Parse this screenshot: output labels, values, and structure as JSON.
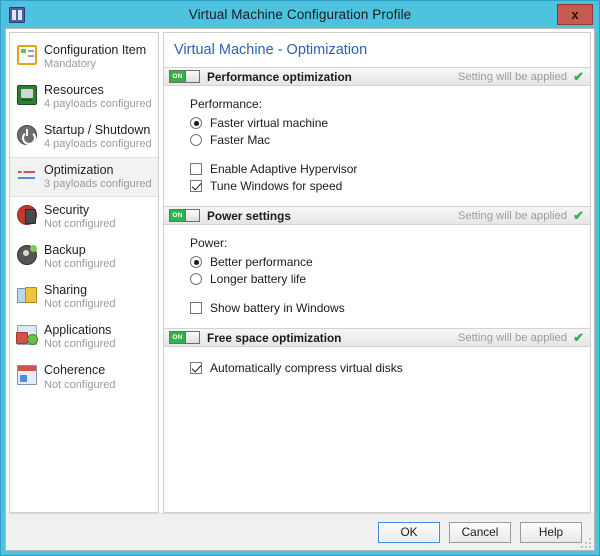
{
  "window": {
    "title": "Virtual Machine Configuration Profile",
    "app_icon": "window-panes-icon",
    "close_label": "x",
    "accent_color": "#4ec3e0",
    "close_color": "#c75b52"
  },
  "sidebar": {
    "items": [
      {
        "label": "Configuration Item",
        "sub": "Mandatory",
        "icon": "config-item-icon",
        "selected": false
      },
      {
        "label": "Resources",
        "sub": "4 payloads configured",
        "icon": "resources-icon",
        "selected": false
      },
      {
        "label": "Startup / Shutdown",
        "sub": "4 payloads configured",
        "icon": "power-icon",
        "selected": false
      },
      {
        "label": "Optimization",
        "sub": "3 payloads configured",
        "icon": "optimization-icon",
        "selected": true
      },
      {
        "label": "Security",
        "sub": "Not configured",
        "icon": "security-icon",
        "selected": false
      },
      {
        "label": "Backup",
        "sub": "Not configured",
        "icon": "backup-icon",
        "selected": false
      },
      {
        "label": "Sharing",
        "sub": "Not configured",
        "icon": "sharing-icon",
        "selected": false
      },
      {
        "label": "Applications",
        "sub": "Not configured",
        "icon": "applications-icon",
        "selected": false
      },
      {
        "label": "Coherence",
        "sub": "Not configured",
        "icon": "coherence-icon",
        "selected": false
      }
    ]
  },
  "main": {
    "heading": "Virtual Machine - Optimization",
    "heading_color": "#2d62b3",
    "status_text": "Setting will be applied",
    "toggle_on_label": "ON",
    "sections": [
      {
        "title": "Performance optimization",
        "status": "Setting will be applied",
        "toggle": "on",
        "group_label": "Performance:",
        "radios": [
          {
            "label": "Faster virtual machine",
            "selected": true
          },
          {
            "label": "Faster Mac",
            "selected": false
          }
        ],
        "checkboxes": [
          {
            "label": "Enable Adaptive Hypervisor",
            "checked": false
          },
          {
            "label": "Tune Windows for speed",
            "checked": true
          }
        ]
      },
      {
        "title": "Power settings",
        "status": "Setting will be applied",
        "toggle": "on",
        "group_label": "Power:",
        "radios": [
          {
            "label": "Better performance",
            "selected": true
          },
          {
            "label": "Longer battery life",
            "selected": false
          }
        ],
        "checkboxes": [
          {
            "label": "Show battery in Windows",
            "checked": false
          }
        ]
      },
      {
        "title": "Free space optimization",
        "status": "Setting will be applied",
        "toggle": "on",
        "group_label": "",
        "radios": [],
        "checkboxes": [
          {
            "label": "Automatically compress virtual disks",
            "checked": true
          }
        ]
      }
    ]
  },
  "footer": {
    "buttons": [
      {
        "label": "OK",
        "default": true
      },
      {
        "label": "Cancel",
        "default": false
      },
      {
        "label": "Help",
        "default": false
      }
    ],
    "resize_grip": "resize-grip-icon"
  }
}
